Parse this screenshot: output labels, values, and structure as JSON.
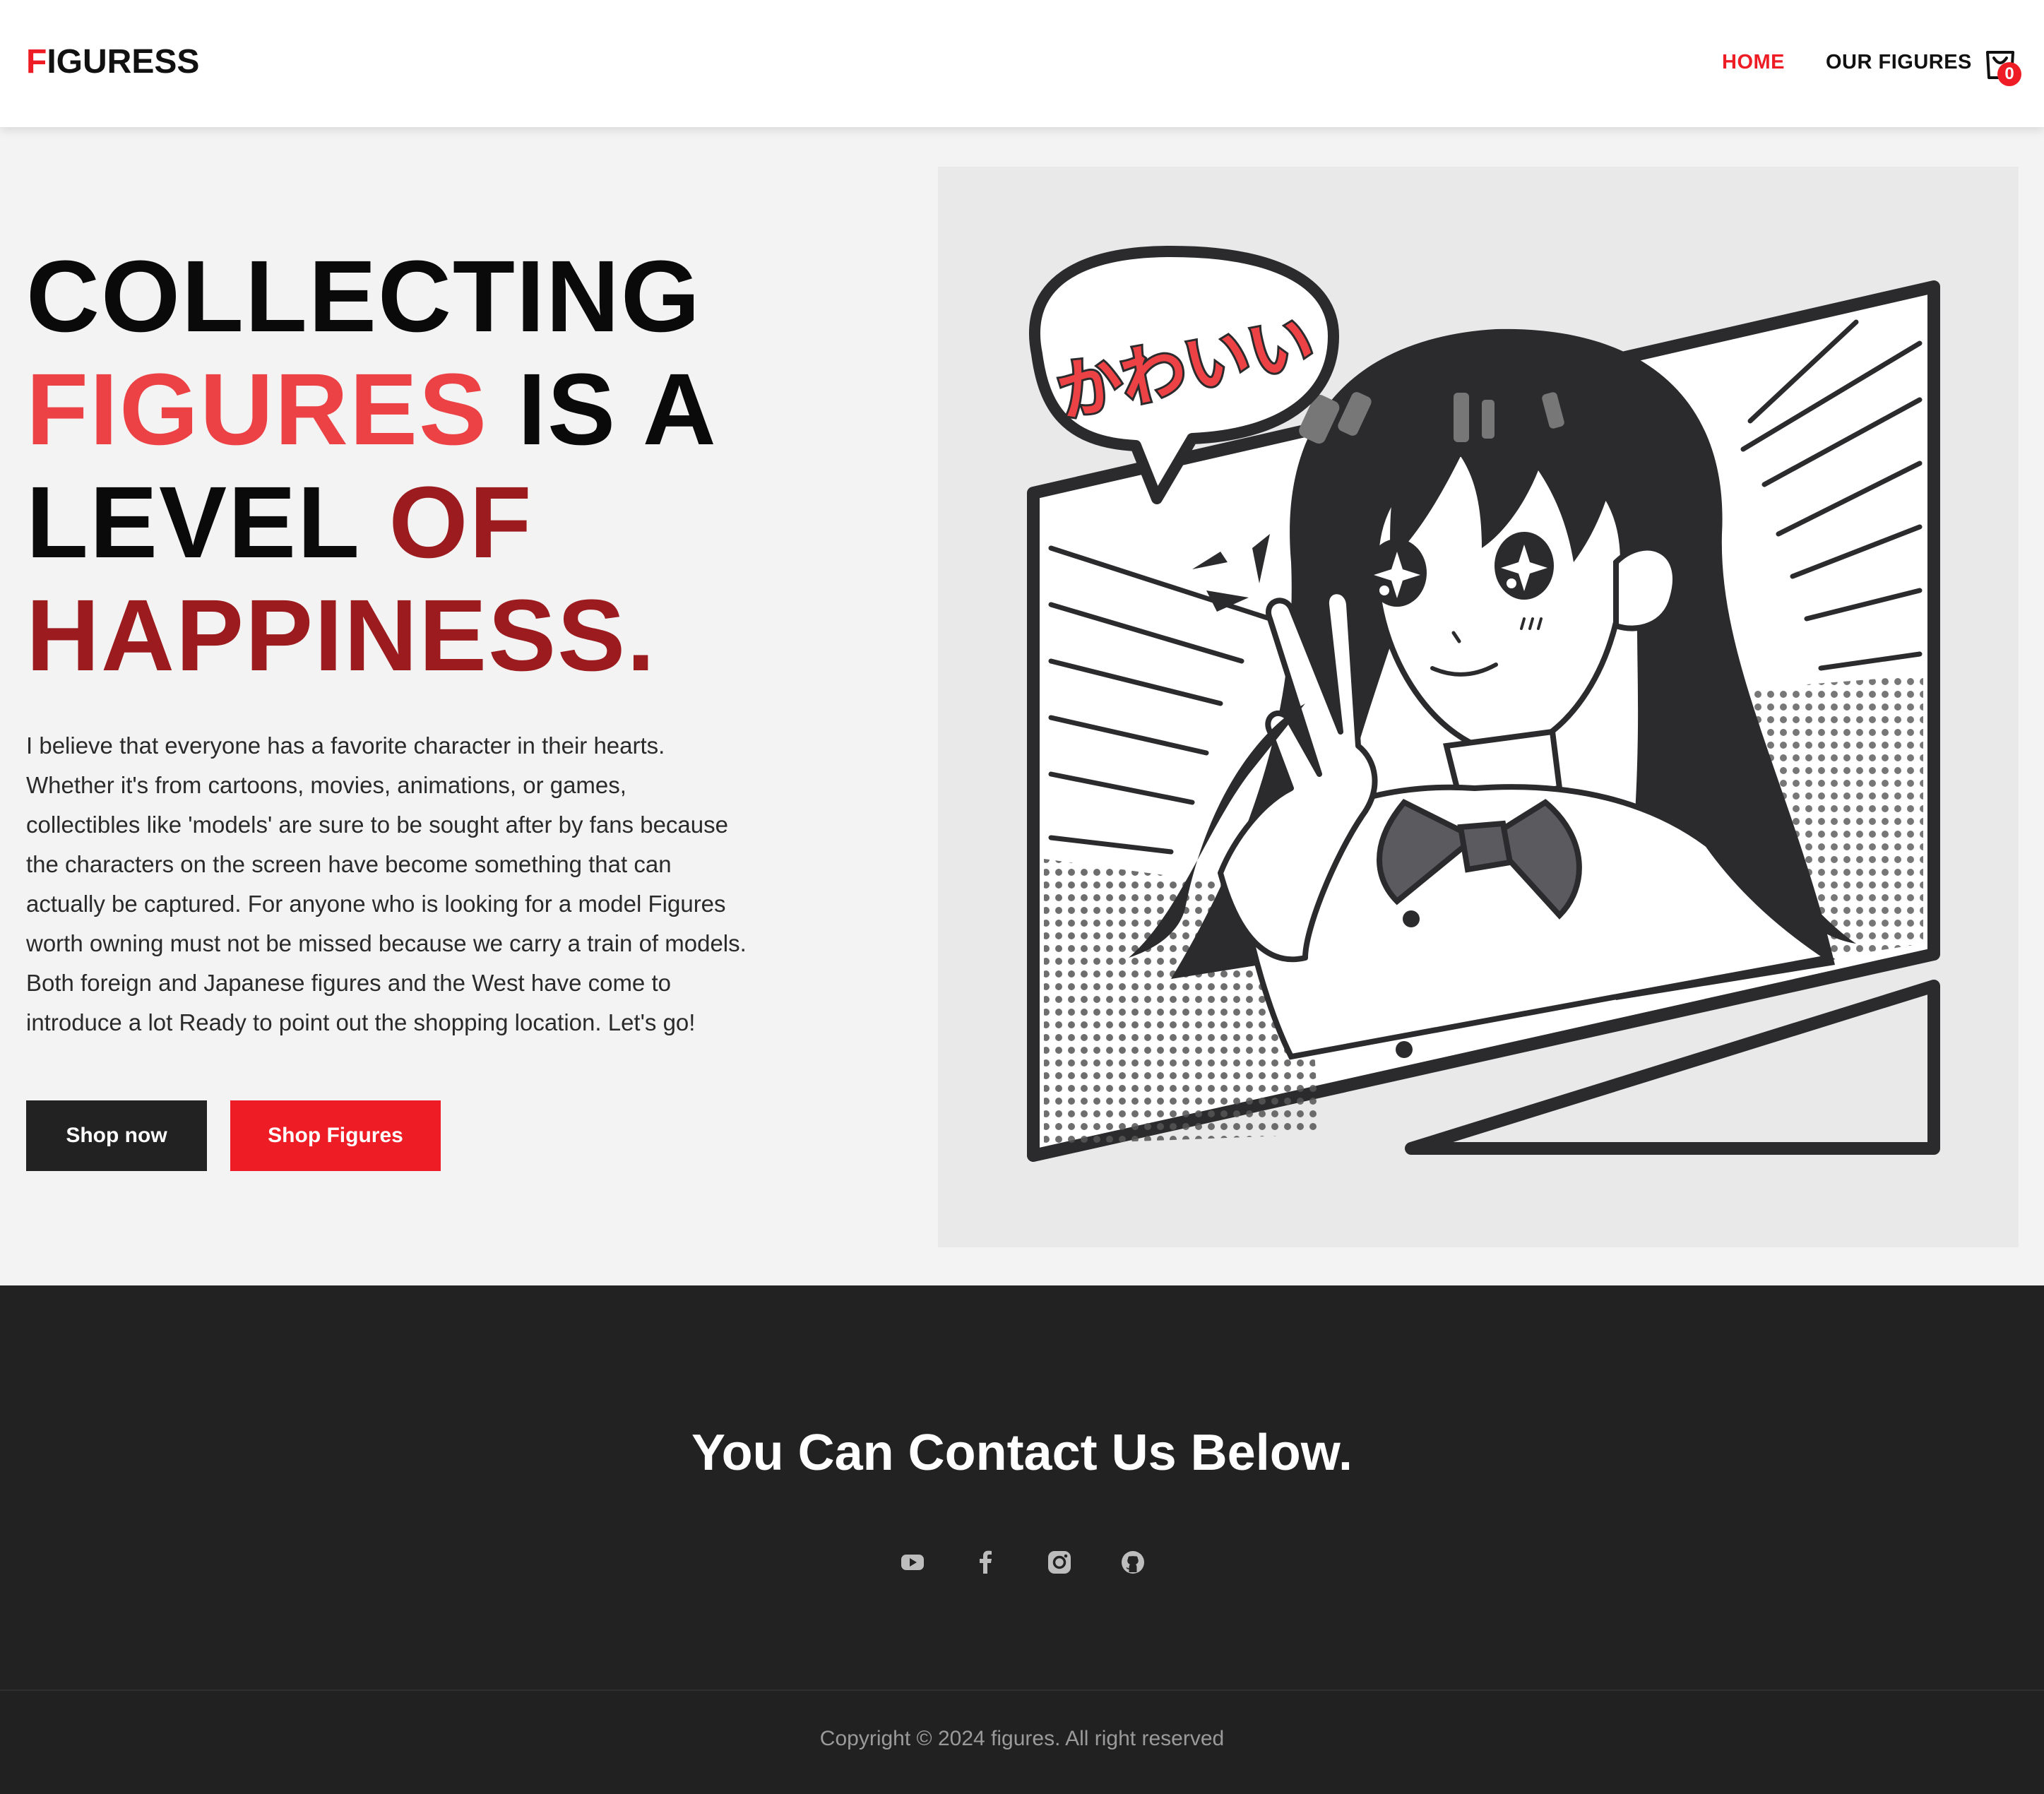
{
  "brand": {
    "first_letter": "F",
    "rest": "IGURESS"
  },
  "nav": {
    "home": "HOME",
    "our_figures": "OUR FIGURES",
    "cart_count": "0"
  },
  "hero": {
    "title_line1": "COLLECTING",
    "title_word_figures": "FIGURES",
    "title_is_a": " IS A",
    "title_level": "LEVEL ",
    "title_of": "OF",
    "title_happiness": "HAPPINESS.",
    "description": "I believe that everyone has a favorite character in their hearts. Whether it's from cartoons, movies, animations, or games, collectibles like 'models' are sure to be sought after by fans because the characters on the screen have become something that can actually be captured. For anyone who is looking for a model Figures worth owning must not be missed because we carry a train of models. Both foreign and Japanese figures and the West have come to introduce a lot Ready to point out the shopping location. Let's go!",
    "btn_shop_now": "Shop now",
    "btn_shop_figures": "Shop Figures",
    "speech_bubble_text": "かわいい"
  },
  "contact": {
    "title": "You Can Contact Us Below.",
    "icons": [
      "youtube-icon",
      "facebook-icon",
      "instagram-icon",
      "github-icon"
    ]
  },
  "footer": {
    "copyright": "Copyright © 2024 figures. All right reserved"
  },
  "colors": {
    "accent": "#ee1c24",
    "accent_light": "#ed4245",
    "accent_dark": "#9b1b1f",
    "dark": "#222222",
    "hero_bg": "#f3f3f3"
  }
}
